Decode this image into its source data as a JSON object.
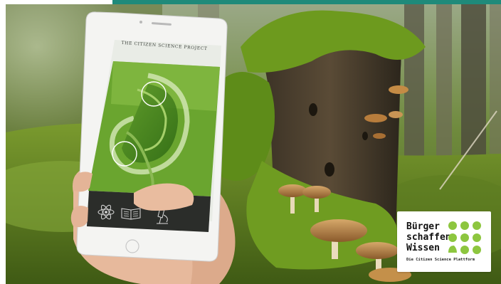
{
  "screen": {
    "title": "THE CITIZEN SCIENCE PROJECT"
  },
  "app_toolbar": {
    "icons": [
      "atom-icon",
      "book-icon",
      "microscope-icon"
    ]
  },
  "logo": {
    "line1": "Bürger",
    "line2": "schaffen",
    "line3": "Wissen",
    "subline": "Die Citizen Science Plattform",
    "dot_color": "#8dc63f"
  },
  "colors": {
    "top_bar": "#1f8a7a",
    "moss": "#6b8e2a",
    "forest_dark": "#2e3d1c"
  }
}
